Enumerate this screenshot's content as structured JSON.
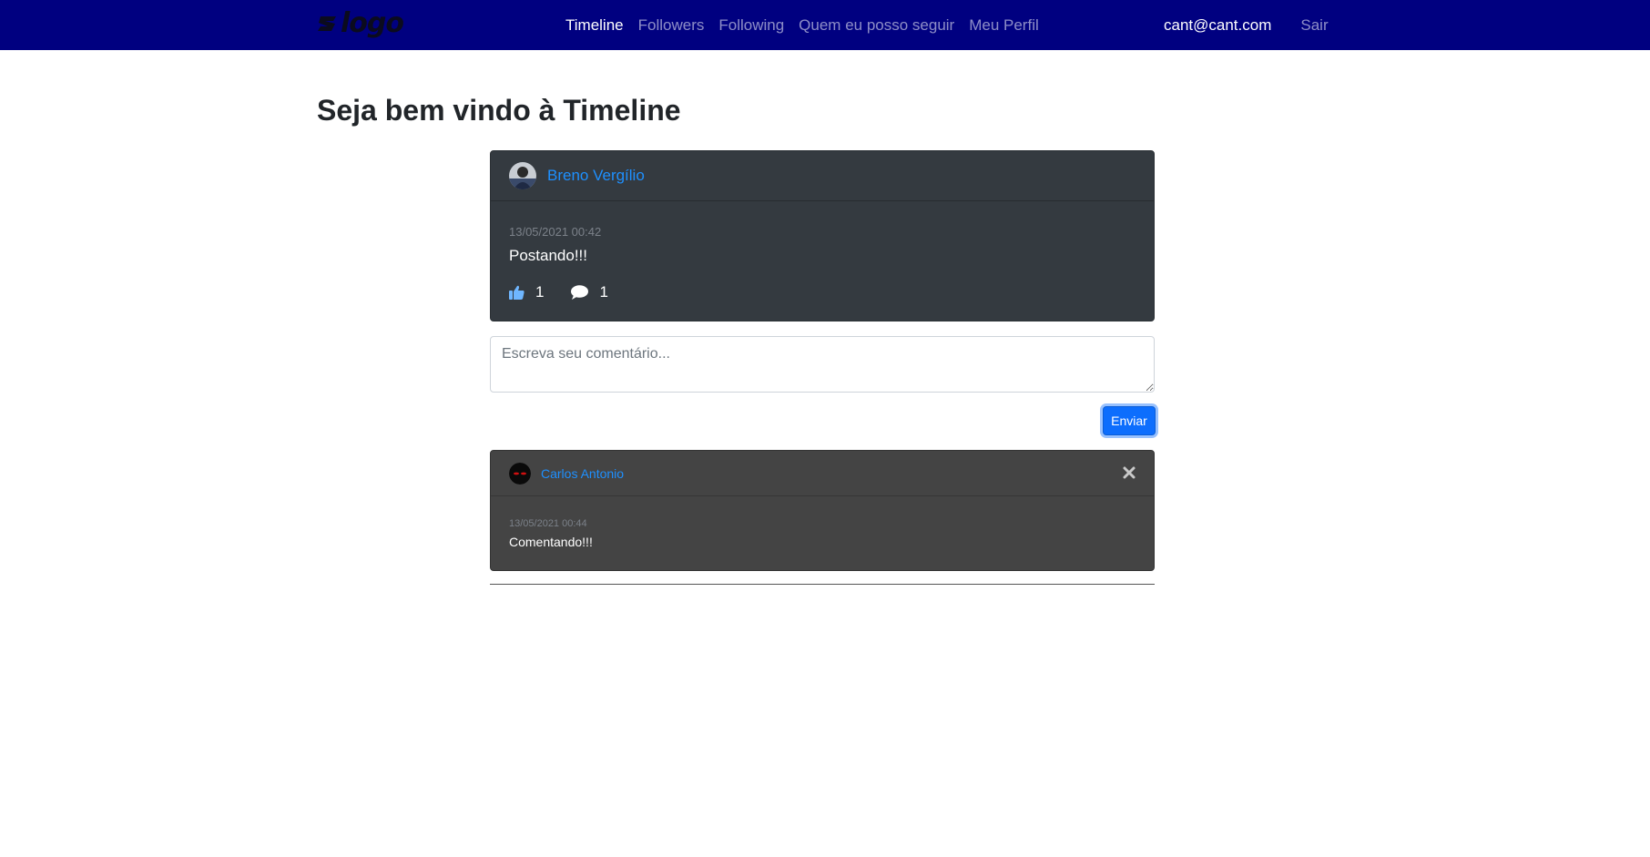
{
  "navbar": {
    "logo_text": "logo",
    "links": [
      {
        "label": "Timeline",
        "active": true
      },
      {
        "label": "Followers",
        "active": false
      },
      {
        "label": "Following",
        "active": false
      },
      {
        "label": "Quem eu posso seguir",
        "active": false
      },
      {
        "label": "Meu Perfil",
        "active": false
      }
    ],
    "user_email": "cant@cant.com",
    "logout_label": "Sair",
    "background_color": "#000080"
  },
  "page_title": "Seja bem vindo à Timeline",
  "post": {
    "author": "Breno Vergílio",
    "date": "13/05/2021 00:42",
    "text": "Postando!!!",
    "likes": "1",
    "comments": "1",
    "icons": {
      "like": "thumbs-up-icon",
      "comment": "comment-icon"
    }
  },
  "comment_form": {
    "placeholder": "Escreva seu comentário...",
    "value": "",
    "submit_label": "Enviar"
  },
  "comments": [
    {
      "author": "Carlos Antonio",
      "date": "13/05/2021 00:44",
      "text": "Comentando!!!",
      "delete_icon": "close-icon"
    }
  ],
  "colors": {
    "link": "#1e90ff",
    "primary_button": "#0d6efd",
    "post_card": "#343a40",
    "comment_card": "#444444"
  }
}
